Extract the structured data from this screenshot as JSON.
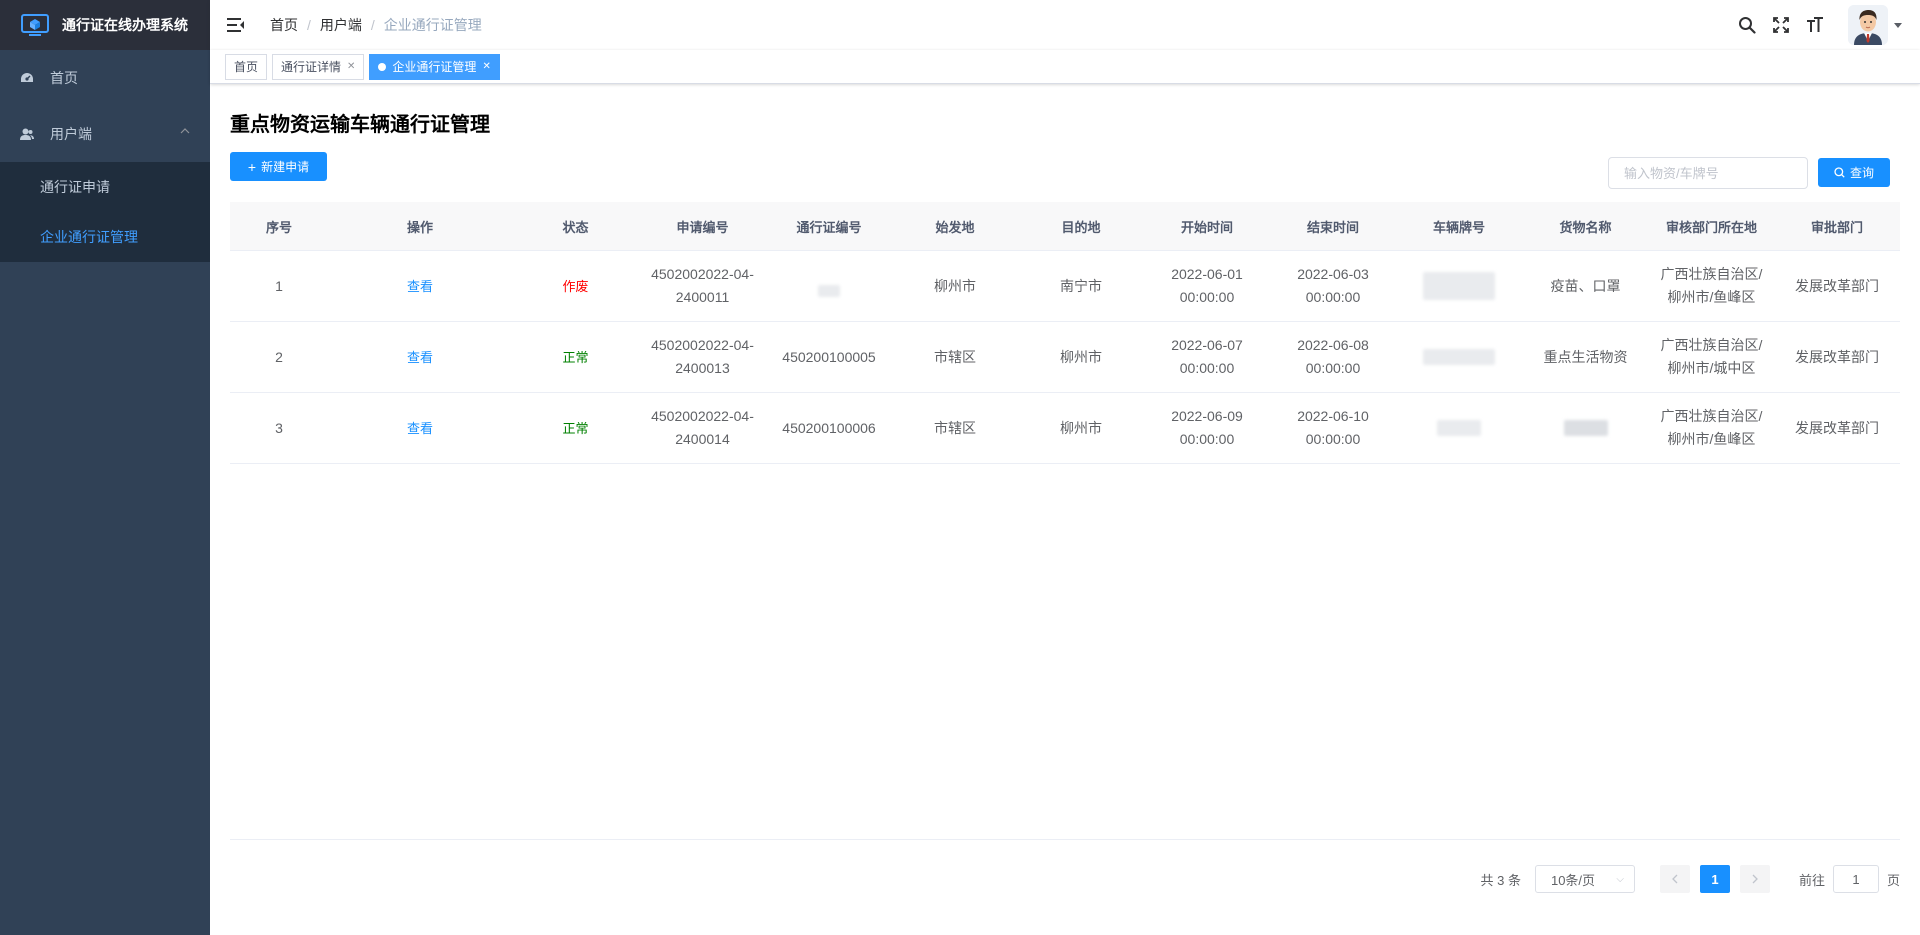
{
  "app": {
    "title": "通行证在线办理系统"
  },
  "sidebar": {
    "items": [
      {
        "label": "首页",
        "icon": "dashboard-icon"
      },
      {
        "label": "用户端",
        "icon": "user-icon",
        "expanded": true,
        "children": [
          {
            "label": "通行证申请",
            "active": false
          },
          {
            "label": "企业通行证管理",
            "active": true
          }
        ]
      }
    ]
  },
  "breadcrumb": [
    "首页",
    "用户端",
    "企业通行证管理"
  ],
  "tags": [
    {
      "label": "首页",
      "active": false,
      "closable": false
    },
    {
      "label": "通行证详情",
      "active": false,
      "closable": true
    },
    {
      "label": "企业通行证管理",
      "active": true,
      "closable": true
    }
  ],
  "page": {
    "title": "重点物资运输车辆通行证管理",
    "new_button": "新建申请",
    "search_placeholder": "输入物资/车牌号",
    "search_value": "",
    "query_button": "查询"
  },
  "table": {
    "headers": [
      "序号",
      "操作",
      "状态",
      "申请编号",
      "通行证编号",
      "始发地",
      "目的地",
      "开始时间",
      "结束时间",
      "车辆牌号",
      "货物名称",
      "审核部门所在地",
      "审批部门"
    ],
    "rows": [
      {
        "index": "1",
        "action": "查看",
        "status": "作废",
        "status_type": "void",
        "apply_no": "4502002022-04-2400011",
        "permit_no": "",
        "from": "柳州市",
        "to": "南宁市",
        "start": "2022-06-01 00:00:00",
        "end": "2022-06-03 00:00:00",
        "plate": "",
        "goods": "疫苗、口罩",
        "location": "广西壮族自治区/柳州市/鱼峰区",
        "dept": "发展改革部门"
      },
      {
        "index": "2",
        "action": "查看",
        "status": "正常",
        "status_type": "ok",
        "apply_no": "4502002022-04-2400013",
        "permit_no": "450200100005",
        "from": "市辖区",
        "to": "柳州市",
        "start": "2022-06-07 00:00:00",
        "end": "2022-06-08 00:00:00",
        "plate": "",
        "goods": "重点生活物资",
        "location": "广西壮族自治区/柳州市/城中区",
        "dept": "发展改革部门"
      },
      {
        "index": "3",
        "action": "查看",
        "status": "正常",
        "status_type": "ok",
        "apply_no": "4502002022-04-2400014",
        "permit_no": "450200100006",
        "from": "市辖区",
        "to": "柳州市",
        "start": "2022-06-09 00:00:00",
        "end": "2022-06-10 00:00:00",
        "plate": "",
        "goods": "",
        "location": "广西壮族自治区/柳州市/鱼峰区",
        "dept": "发展改革部门"
      }
    ]
  },
  "pagination": {
    "total_text": "共 3 条",
    "page_size": "10条/页",
    "current_page": "1",
    "goto_label": "前往",
    "goto_value": "1",
    "page_unit": "页"
  },
  "colors": {
    "sidebar_bg": "#304156",
    "logo_bg": "#2b2f3a",
    "submenu_bg": "#1f2d3d",
    "primary": "#1890ff",
    "status_void": "#ff0000",
    "status_ok": "#008000"
  }
}
